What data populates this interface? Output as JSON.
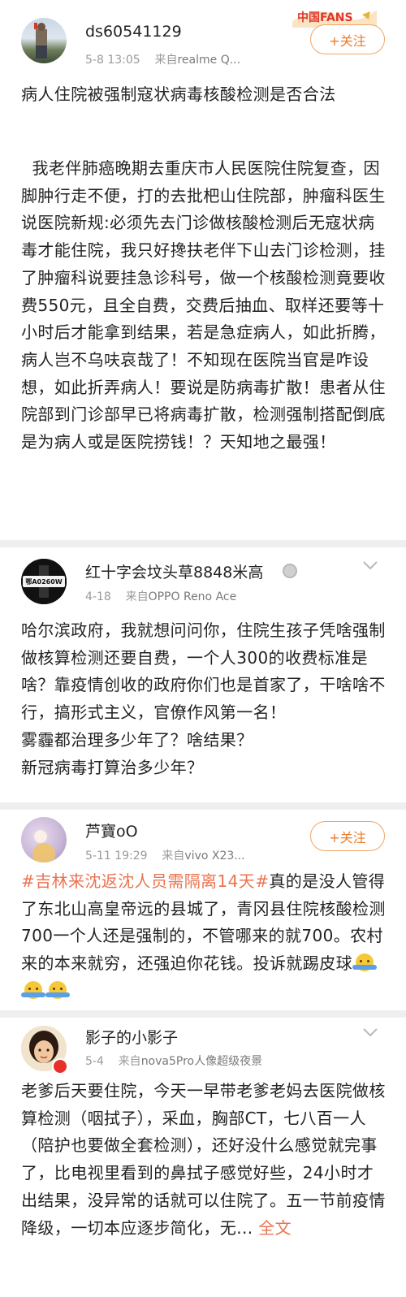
{
  "posts": [
    {
      "username": "ds60541129",
      "time": "5-8 13:05",
      "source_prefix": "来自",
      "source": "realme Q...",
      "follow_label": "+关注",
      "badge_text": "中国FANS",
      "title": "病人住院被强制寇状病毒核酸检测是否合法",
      "body": "  我老伴肺癌晚期去重庆市人民医院住院复查，因脚肿行走不便，打的去批杷山住院部，肿瘤科医生说医院新规:必须先去门诊做核酸检测后无寇状病毒才能住院，我只好搀扶老伴下山去门诊检测，挂了肿瘤科说要挂急诊科号，做一个核酸检测竟要收费550元，且全自费，交费后抽血、取样还要等十小时后才能拿到结果，若是急症病人，如此折腾，病人岂不乌呋哀哉了！不知现在医院当官是咋设想，如此折弄病人！要说是防病毒扩散！患者从住院部到门诊部早已将病毒扩散，检测强制搭配倒底是为病人或是医院捞钱！？天知地之最强！"
    },
    {
      "username": "红十字会坟头草8848米高",
      "time": "4-18",
      "source_prefix": "来自",
      "source": "OPPO Reno Ace",
      "avatar_text": "鄂A0260W",
      "body": "哈尔滨政府，我就想问问你，住院生孩子凭啥强制做核算检测还要自费，一个人300的收费标准是啥？靠疫情创收的政府你们也是首家了，干啥啥不行，搞形式主义，官僚作风第一名！\n雾霾都治理多少年了？啥结果？\n新冠病毒打算治多少年？"
    },
    {
      "username": "芦寶oO",
      "time": "5-11 19:29",
      "source_prefix": "来自",
      "source": "vivo X23...",
      "follow_label": "+关注",
      "hashtag": "#吉林来沈返沈人员需隔离14天#",
      "body": "真的是没人管得了东北山高皇帝远的县城了，青冈县住院核酸检测700一个人还是强制的，不管哪来的就700。农村来的本来就穷，还强迫你花钱。投诉就踢皮球"
    },
    {
      "username": "影子的小影子",
      "time": "5-4",
      "source_prefix": "来自",
      "source": "nova5Pro人像超级夜景",
      "body": "老爹后天要住院，今天一早带老爹老妈去医院做核算检测（咽拭子），采血，胸部CT，七八百一人（陪护也要做全套检测），还好没什么感觉就完事了，比电视里看到的鼻拭子感觉好些，24小时才出结果，没异常的话就可以住院了。五一节前疫情降级，一切本应逐步简化，无...",
      "more_label": "全文"
    }
  ],
  "icons": {
    "follow": "plus-icon",
    "menu": "chevron-down-icon",
    "emoji": "shrug-emoji-icon"
  },
  "colors": {
    "accent": "#eb7350",
    "follow_border": "#f1a566",
    "meta": "#9a9a9a",
    "divider": "#efefef"
  }
}
